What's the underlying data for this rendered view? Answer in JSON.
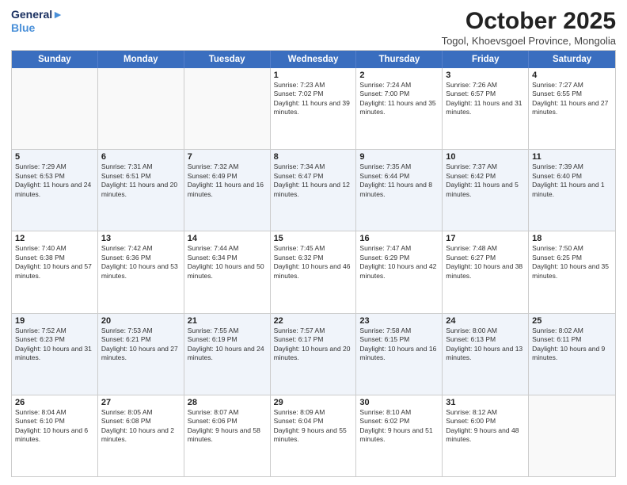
{
  "logo": {
    "line1": "General",
    "line2": "Blue"
  },
  "title": "October 2025",
  "subtitle": "Togol, Khoevsgoel Province, Mongolia",
  "days_of_week": [
    "Sunday",
    "Monday",
    "Tuesday",
    "Wednesday",
    "Thursday",
    "Friday",
    "Saturday"
  ],
  "weeks": [
    [
      {
        "num": "",
        "info": ""
      },
      {
        "num": "",
        "info": ""
      },
      {
        "num": "",
        "info": ""
      },
      {
        "num": "1",
        "info": "Sunrise: 7:23 AM\nSunset: 7:02 PM\nDaylight: 11 hours and 39 minutes."
      },
      {
        "num": "2",
        "info": "Sunrise: 7:24 AM\nSunset: 7:00 PM\nDaylight: 11 hours and 35 minutes."
      },
      {
        "num": "3",
        "info": "Sunrise: 7:26 AM\nSunset: 6:57 PM\nDaylight: 11 hours and 31 minutes."
      },
      {
        "num": "4",
        "info": "Sunrise: 7:27 AM\nSunset: 6:55 PM\nDaylight: 11 hours and 27 minutes."
      }
    ],
    [
      {
        "num": "5",
        "info": "Sunrise: 7:29 AM\nSunset: 6:53 PM\nDaylight: 11 hours and 24 minutes."
      },
      {
        "num": "6",
        "info": "Sunrise: 7:31 AM\nSunset: 6:51 PM\nDaylight: 11 hours and 20 minutes."
      },
      {
        "num": "7",
        "info": "Sunrise: 7:32 AM\nSunset: 6:49 PM\nDaylight: 11 hours and 16 minutes."
      },
      {
        "num": "8",
        "info": "Sunrise: 7:34 AM\nSunset: 6:47 PM\nDaylight: 11 hours and 12 minutes."
      },
      {
        "num": "9",
        "info": "Sunrise: 7:35 AM\nSunset: 6:44 PM\nDaylight: 11 hours and 8 minutes."
      },
      {
        "num": "10",
        "info": "Sunrise: 7:37 AM\nSunset: 6:42 PM\nDaylight: 11 hours and 5 minutes."
      },
      {
        "num": "11",
        "info": "Sunrise: 7:39 AM\nSunset: 6:40 PM\nDaylight: 11 hours and 1 minute."
      }
    ],
    [
      {
        "num": "12",
        "info": "Sunrise: 7:40 AM\nSunset: 6:38 PM\nDaylight: 10 hours and 57 minutes."
      },
      {
        "num": "13",
        "info": "Sunrise: 7:42 AM\nSunset: 6:36 PM\nDaylight: 10 hours and 53 minutes."
      },
      {
        "num": "14",
        "info": "Sunrise: 7:44 AM\nSunset: 6:34 PM\nDaylight: 10 hours and 50 minutes."
      },
      {
        "num": "15",
        "info": "Sunrise: 7:45 AM\nSunset: 6:32 PM\nDaylight: 10 hours and 46 minutes."
      },
      {
        "num": "16",
        "info": "Sunrise: 7:47 AM\nSunset: 6:29 PM\nDaylight: 10 hours and 42 minutes."
      },
      {
        "num": "17",
        "info": "Sunrise: 7:48 AM\nSunset: 6:27 PM\nDaylight: 10 hours and 38 minutes."
      },
      {
        "num": "18",
        "info": "Sunrise: 7:50 AM\nSunset: 6:25 PM\nDaylight: 10 hours and 35 minutes."
      }
    ],
    [
      {
        "num": "19",
        "info": "Sunrise: 7:52 AM\nSunset: 6:23 PM\nDaylight: 10 hours and 31 minutes."
      },
      {
        "num": "20",
        "info": "Sunrise: 7:53 AM\nSunset: 6:21 PM\nDaylight: 10 hours and 27 minutes."
      },
      {
        "num": "21",
        "info": "Sunrise: 7:55 AM\nSunset: 6:19 PM\nDaylight: 10 hours and 24 minutes."
      },
      {
        "num": "22",
        "info": "Sunrise: 7:57 AM\nSunset: 6:17 PM\nDaylight: 10 hours and 20 minutes."
      },
      {
        "num": "23",
        "info": "Sunrise: 7:58 AM\nSunset: 6:15 PM\nDaylight: 10 hours and 16 minutes."
      },
      {
        "num": "24",
        "info": "Sunrise: 8:00 AM\nSunset: 6:13 PM\nDaylight: 10 hours and 13 minutes."
      },
      {
        "num": "25",
        "info": "Sunrise: 8:02 AM\nSunset: 6:11 PM\nDaylight: 10 hours and 9 minutes."
      }
    ],
    [
      {
        "num": "26",
        "info": "Sunrise: 8:04 AM\nSunset: 6:10 PM\nDaylight: 10 hours and 6 minutes."
      },
      {
        "num": "27",
        "info": "Sunrise: 8:05 AM\nSunset: 6:08 PM\nDaylight: 10 hours and 2 minutes."
      },
      {
        "num": "28",
        "info": "Sunrise: 8:07 AM\nSunset: 6:06 PM\nDaylight: 9 hours and 58 minutes."
      },
      {
        "num": "29",
        "info": "Sunrise: 8:09 AM\nSunset: 6:04 PM\nDaylight: 9 hours and 55 minutes."
      },
      {
        "num": "30",
        "info": "Sunrise: 8:10 AM\nSunset: 6:02 PM\nDaylight: 9 hours and 51 minutes."
      },
      {
        "num": "31",
        "info": "Sunrise: 8:12 AM\nSunset: 6:00 PM\nDaylight: 9 hours and 48 minutes."
      },
      {
        "num": "",
        "info": ""
      }
    ]
  ]
}
